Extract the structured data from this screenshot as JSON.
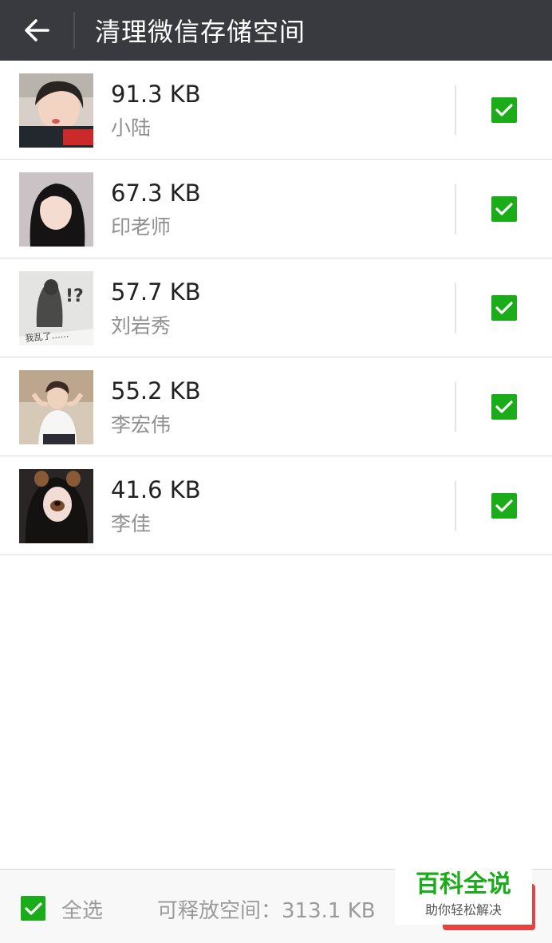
{
  "header": {
    "title": "清理微信存储空间",
    "back_icon": "arrow-left-icon",
    "background": "#393a3f"
  },
  "items": [
    {
      "size": "91.3 KB",
      "name": "小陆",
      "checked": true
    },
    {
      "size": "67.3 KB",
      "name": "印老师",
      "checked": true
    },
    {
      "size": "57.7 KB",
      "name": "刘岩秀",
      "checked": true,
      "avatar_text": "我乱了……"
    },
    {
      "size": "55.2 KB",
      "name": "李宏伟",
      "checked": true
    },
    {
      "size": "41.6 KB",
      "name": "李佳",
      "checked": true
    }
  ],
  "footer": {
    "select_all_label": "全选",
    "select_all_checked": true,
    "free_space_label": "可释放空间：313.1 KB"
  },
  "watermark": {
    "title": "百科全说",
    "subtitle": "助你轻松解决"
  },
  "colors": {
    "accent_green": "#1aad19",
    "delete_red": "#e64340"
  }
}
